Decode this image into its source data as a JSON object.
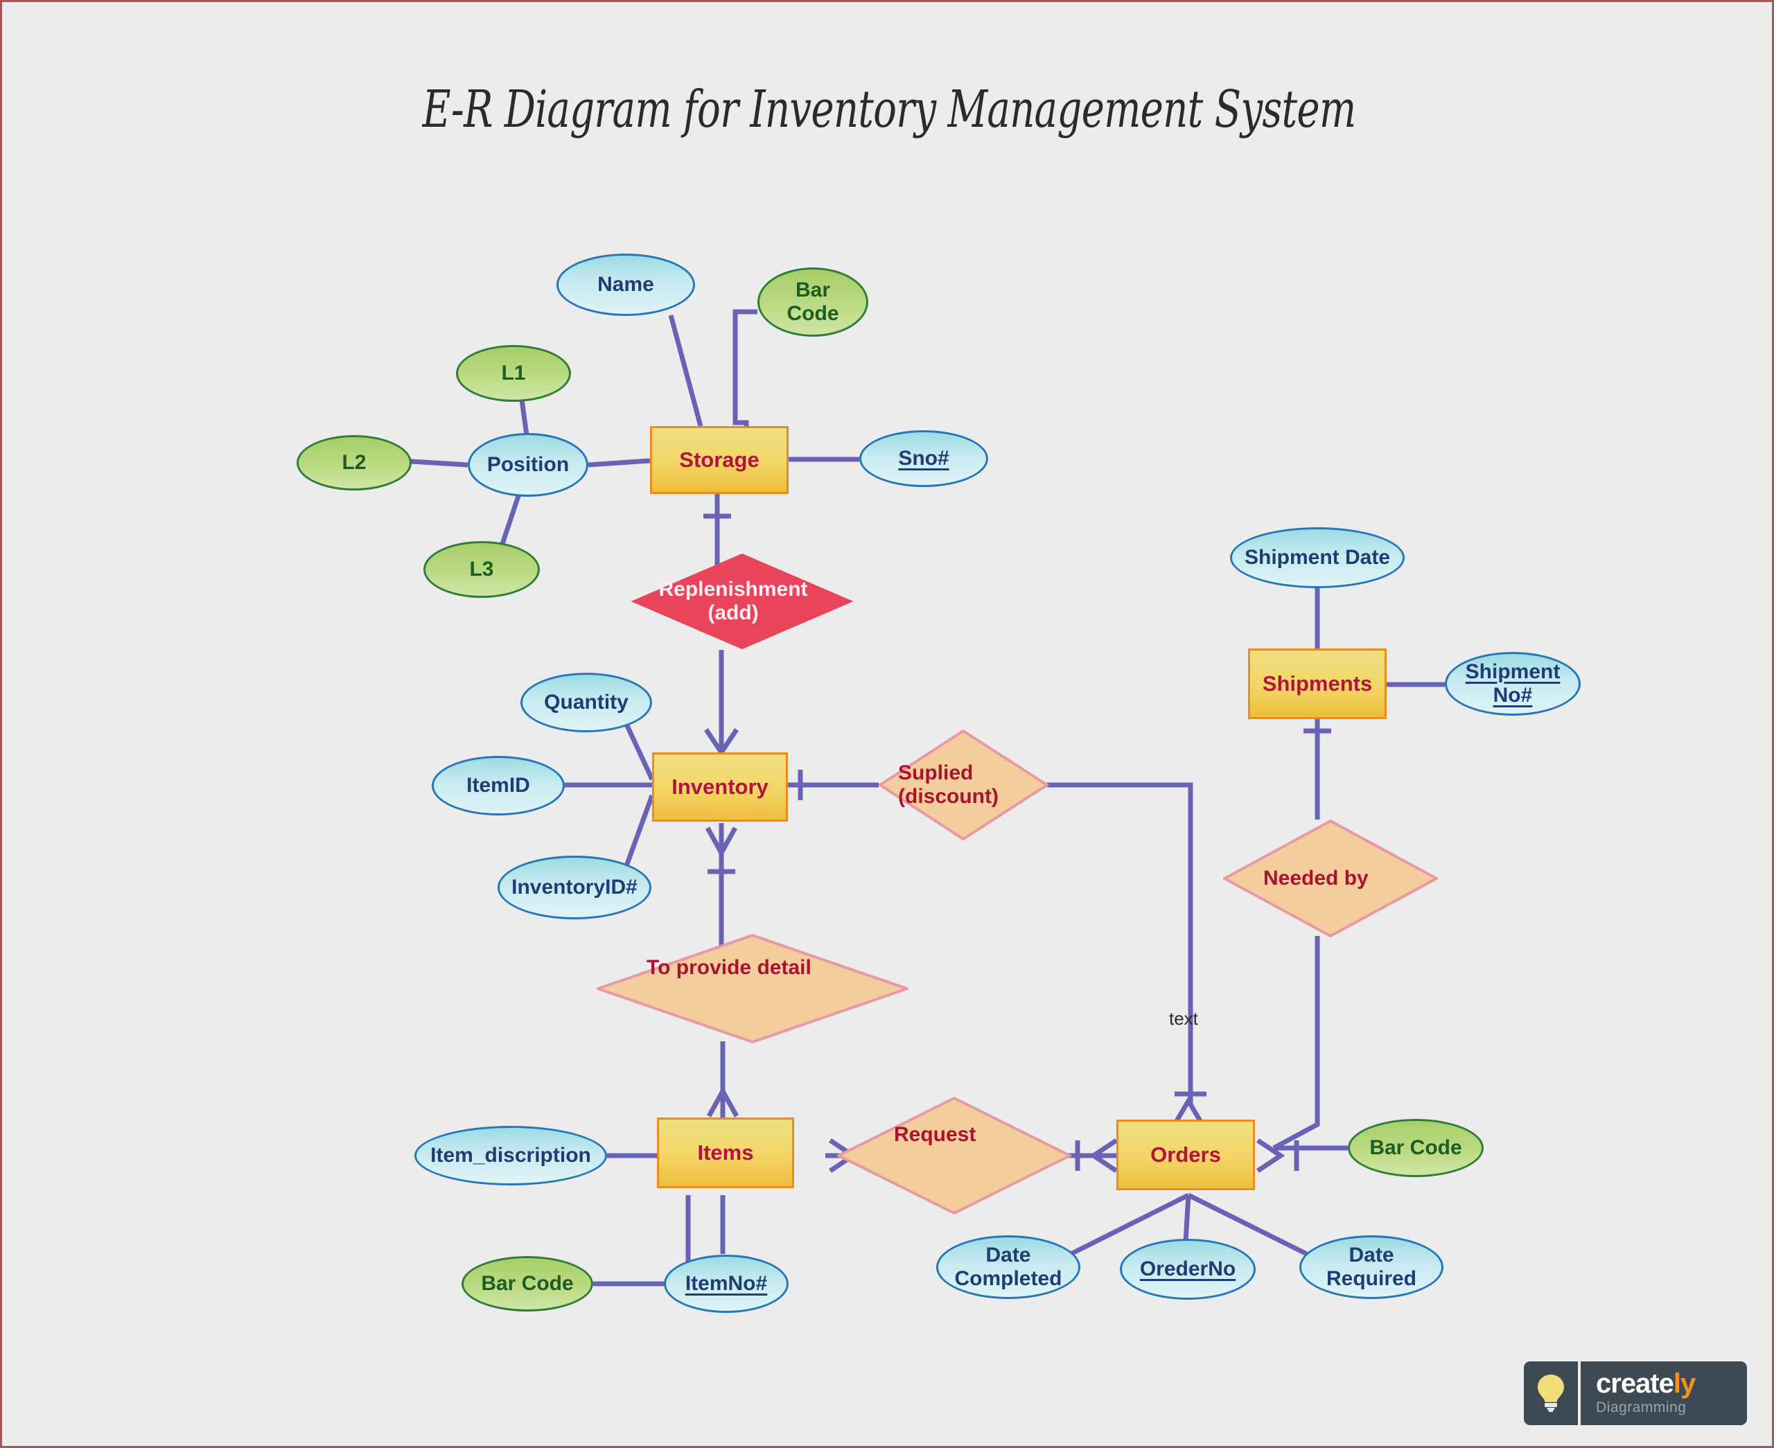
{
  "title": "E-R Diagram for Inventory Management System",
  "colors": {
    "canvas_bg": "#ececec",
    "page_border": "#a45a5a",
    "connector": "#6a63b5",
    "entity_fill": "#f0d35f",
    "entity_border": "#ef8a1e",
    "entity_text": "#b4123f",
    "attr_blue_fill": "#cdeef2",
    "attr_blue_border": "#2676b8",
    "attr_blue_text": "#1f3d73",
    "attr_green_fill": "#bcdb86",
    "attr_green_border": "#2f7d38",
    "attr_green_text": "#1d5c23",
    "rel_peach_fill": "#f3cd9b",
    "rel_peach_border": "#e79aa4",
    "rel_red_fill": "#e8445c",
    "rel_text": "#a8142f"
  },
  "entities": [
    {
      "id": "storage",
      "label": "Storage"
    },
    {
      "id": "inventory",
      "label": "Inventory"
    },
    {
      "id": "items",
      "label": "Items"
    },
    {
      "id": "orders",
      "label": "Orders"
    },
    {
      "id": "shipments",
      "label": "Shipments"
    }
  ],
  "attributes": [
    {
      "id": "name",
      "label": "Name",
      "style": "blue",
      "key": false
    },
    {
      "id": "barcode_storage",
      "label": "Bar\nCode",
      "style": "green",
      "key": false
    },
    {
      "id": "sno",
      "label": "Sno#",
      "style": "blue",
      "key": true
    },
    {
      "id": "position",
      "label": "Position",
      "style": "blue",
      "key": false
    },
    {
      "id": "l1",
      "label": "L1",
      "style": "green",
      "key": false
    },
    {
      "id": "l2",
      "label": "L2",
      "style": "green",
      "key": false
    },
    {
      "id": "l3",
      "label": "L3",
      "style": "green",
      "key": false
    },
    {
      "id": "quantity",
      "label": "Quantity",
      "style": "blue",
      "key": false
    },
    {
      "id": "itemid",
      "label": "ItemID",
      "style": "blue",
      "key": false
    },
    {
      "id": "inventoryid",
      "label": "InventoryID#",
      "style": "blue",
      "key": false
    },
    {
      "id": "item_discription",
      "label": "Item_discription",
      "style": "blue",
      "key": false
    },
    {
      "id": "barcode_items",
      "label": "Bar Code",
      "style": "green",
      "key": false
    },
    {
      "id": "itemno",
      "label": "ItemNo#",
      "style": "blue",
      "key": true
    },
    {
      "id": "date_completed",
      "label": "Date\nCompleted",
      "style": "blue",
      "key": false
    },
    {
      "id": "orderno",
      "label": "OrederNo",
      "style": "blue",
      "key": true
    },
    {
      "id": "date_required",
      "label": "Date\nRequired",
      "style": "blue",
      "key": false
    },
    {
      "id": "barcode_orders",
      "label": "Bar Code",
      "style": "green",
      "key": false
    },
    {
      "id": "shipment_date",
      "label": "Shipment Date",
      "style": "blue",
      "key": false
    },
    {
      "id": "shipment_no",
      "label": "Shipment\nNo#",
      "style": "blue",
      "key": true
    }
  ],
  "relationships": [
    {
      "id": "replenishment",
      "label": "Replenishment\n(add)",
      "style": "red"
    },
    {
      "id": "suplied",
      "label": "Suplied\n(discount)",
      "style": "peach"
    },
    {
      "id": "to_provide_detail",
      "label": "To provide detail",
      "style": "peach"
    },
    {
      "id": "request",
      "label": "Request",
      "style": "peach"
    },
    {
      "id": "needed_by",
      "label": "Needed by",
      "style": "peach"
    }
  ],
  "annotations": [
    {
      "id": "text_label",
      "label": "text"
    }
  ],
  "watermark": {
    "word_main": "creat",
    "word_accent": "ly",
    "word_e": "e",
    "subtitle": "Diagramming",
    "icon": "lightbulb-icon"
  }
}
